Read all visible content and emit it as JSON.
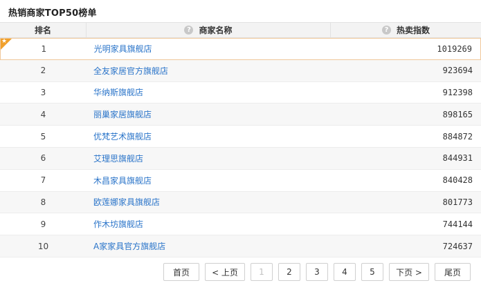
{
  "page": {
    "title": "热销商家TOP50榜单"
  },
  "table": {
    "headers": {
      "rank": "排名",
      "name": "商家名称",
      "index": "热卖指数"
    },
    "help_icon_glyph": "?",
    "rows": [
      {
        "rank": "1",
        "name": "光明家具旗舰店",
        "index": "1019269"
      },
      {
        "rank": "2",
        "name": "全友家居官方旗舰店",
        "index": "923694"
      },
      {
        "rank": "3",
        "name": "华纳斯旗舰店",
        "index": "912398"
      },
      {
        "rank": "4",
        "name": "丽巢家居旗舰店",
        "index": "898165"
      },
      {
        "rank": "5",
        "name": "优梵艺术旗舰店",
        "index": "884872"
      },
      {
        "rank": "6",
        "name": "艾理思旗舰店",
        "index": "844931"
      },
      {
        "rank": "7",
        "name": "木昌家具旗舰店",
        "index": "840428"
      },
      {
        "rank": "8",
        "name": "欧莲娜家具旗舰店",
        "index": "801773"
      },
      {
        "rank": "9",
        "name": "作木坊旗舰店",
        "index": "744144"
      },
      {
        "rank": "10",
        "name": "A家家具官方旗舰店",
        "index": "724637"
      }
    ]
  },
  "pager": {
    "first": "首页",
    "prev": "< 上页",
    "pages": [
      "1",
      "2",
      "3",
      "4",
      "5"
    ],
    "current": "1",
    "next": "下页 >",
    "last": "尾页"
  },
  "colors": {
    "link": "#2a74c9",
    "badge": "#f0a02c",
    "highlight_border": "#f0c89a"
  }
}
